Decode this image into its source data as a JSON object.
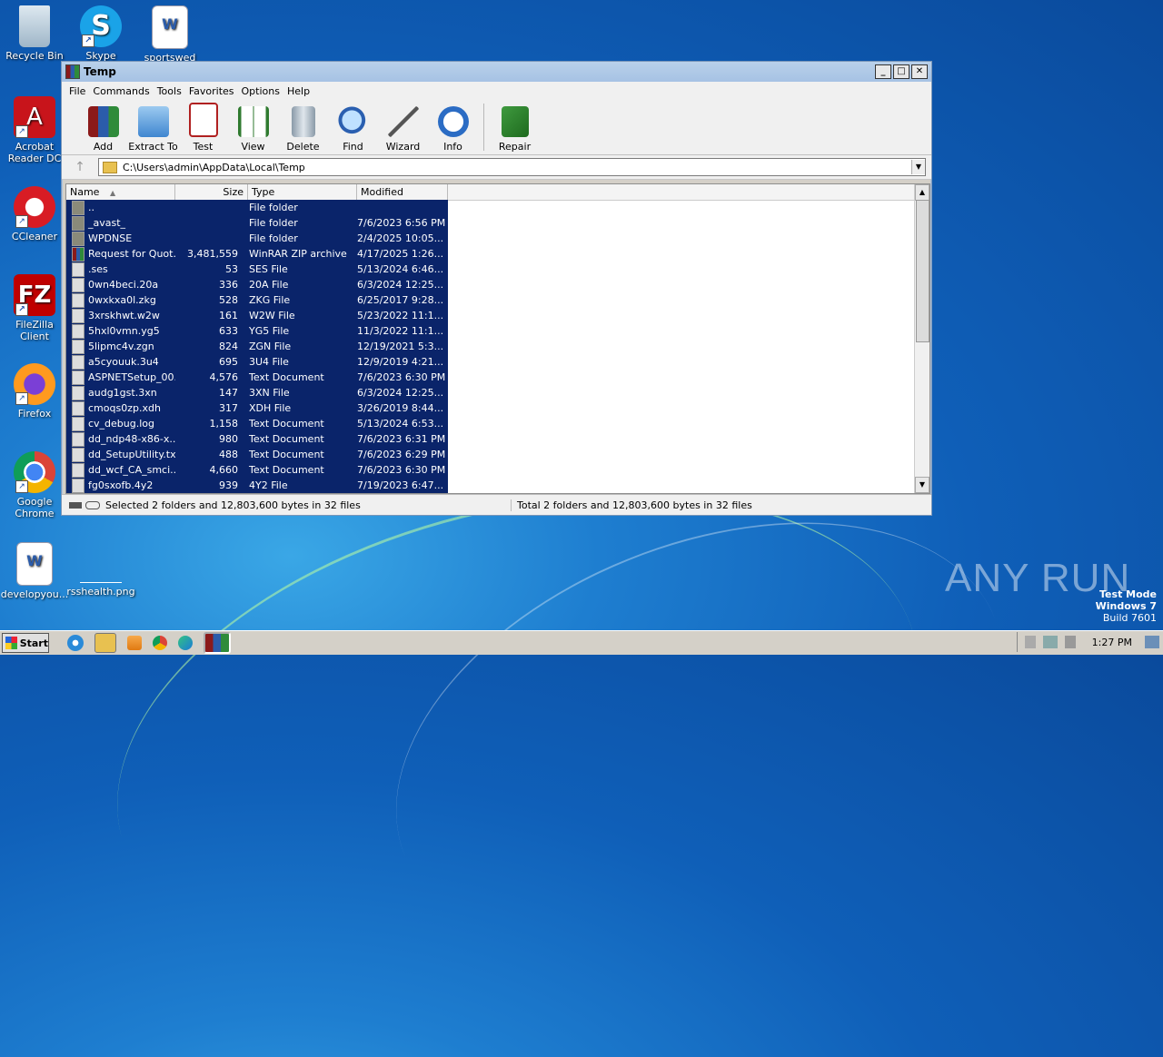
{
  "desktop": {
    "icons": [
      {
        "label": "Recycle Bin",
        "icon": "recycle-bin-icon"
      },
      {
        "label": "Skype",
        "icon": "skype-icon"
      },
      {
        "label": "sportswed",
        "icon": "word-doc-icon"
      },
      {
        "label": "Acrobat Reader DC",
        "icon": "acrobat-icon"
      },
      {
        "label": "CCleaner",
        "icon": "ccleaner-icon"
      },
      {
        "label": "FileZilla Client",
        "icon": "filezilla-icon"
      },
      {
        "label": "Firefox",
        "icon": "firefox-icon"
      },
      {
        "label": "Google Chrome",
        "icon": "chrome-icon"
      },
      {
        "label": "developyou...",
        "icon": "word-doc-icon"
      },
      {
        "label": "rsshealth.png",
        "icon": "image-file-icon"
      }
    ],
    "watermark": {
      "mode": "Test Mode",
      "os": "Windows 7",
      "build": "Build 7601"
    },
    "brand": "ANY RUN"
  },
  "window": {
    "title": "Temp",
    "menu": [
      "File",
      "Commands",
      "Tools",
      "Favorites",
      "Options",
      "Help"
    ],
    "toolbar": [
      "Add",
      "Extract To",
      "Test",
      "View",
      "Delete",
      "Find",
      "Wizard",
      "Info",
      "Repair"
    ],
    "address": "C:\\Users\\admin\\AppData\\Local\\Temp",
    "columns": {
      "name": "Name",
      "size": "Size",
      "type": "Type",
      "modified": "Modified"
    },
    "files": [
      {
        "name": "..",
        "size": "",
        "type": "File folder",
        "modified": "",
        "kind": "folder"
      },
      {
        "name": "_avast_",
        "size": "",
        "type": "File folder",
        "modified": "7/6/2023 6:56 PM",
        "kind": "folder"
      },
      {
        "name": "WPDNSE",
        "size": "",
        "type": "File folder",
        "modified": "2/4/2025 10:05...",
        "kind": "folder"
      },
      {
        "name": "Request for Quot...",
        "size": "3,481,559",
        "type": "WinRAR ZIP archive",
        "modified": "4/17/2025 1:26...",
        "kind": "zip"
      },
      {
        "name": ".ses",
        "size": "53",
        "type": "SES File",
        "modified": "5/13/2024 6:46...",
        "kind": "file"
      },
      {
        "name": "0wn4beci.20a",
        "size": "336",
        "type": "20A File",
        "modified": "6/3/2024 12:25...",
        "kind": "file"
      },
      {
        "name": "0wxkxa0l.zkg",
        "size": "528",
        "type": "ZKG File",
        "modified": "6/25/2017 9:28...",
        "kind": "file"
      },
      {
        "name": "3xrskhwt.w2w",
        "size": "161",
        "type": "W2W File",
        "modified": "5/23/2022 11:1...",
        "kind": "file"
      },
      {
        "name": "5hxl0vmn.yg5",
        "size": "633",
        "type": "YG5 File",
        "modified": "11/3/2022 11:1...",
        "kind": "file"
      },
      {
        "name": "5lipmc4v.zgn",
        "size": "824",
        "type": "ZGN File",
        "modified": "12/19/2021 5:3...",
        "kind": "file"
      },
      {
        "name": "a5cyouuk.3u4",
        "size": "695",
        "type": "3U4 File",
        "modified": "12/9/2019 4:21...",
        "kind": "file"
      },
      {
        "name": "ASPNETSetup_00...",
        "size": "4,576",
        "type": "Text Document",
        "modified": "7/6/2023 6:30 PM",
        "kind": "file"
      },
      {
        "name": "audg1gst.3xn",
        "size": "147",
        "type": "3XN File",
        "modified": "6/3/2024 12:25...",
        "kind": "file"
      },
      {
        "name": "cmoqs0zp.xdh",
        "size": "317",
        "type": "XDH File",
        "modified": "3/26/2019 8:44...",
        "kind": "file"
      },
      {
        "name": "cv_debug.log",
        "size": "1,158",
        "type": "Text Document",
        "modified": "5/13/2024 6:53...",
        "kind": "file"
      },
      {
        "name": "dd_ndp48-x86-x...",
        "size": "980",
        "type": "Text Document",
        "modified": "7/6/2023 6:31 PM",
        "kind": "file"
      },
      {
        "name": "dd_SetupUtility.txt",
        "size": "488",
        "type": "Text Document",
        "modified": "7/6/2023 6:29 PM",
        "kind": "file"
      },
      {
        "name": "dd_wcf_CA_smci...",
        "size": "4,660",
        "type": "Text Document",
        "modified": "7/6/2023 6:30 PM",
        "kind": "file"
      },
      {
        "name": "fg0sxofb.4y2",
        "size": "939",
        "type": "4Y2 File",
        "modified": "7/19/2023 6:47...",
        "kind": "file"
      }
    ],
    "status_left": "Selected 2 folders and 12,803,600 bytes in 32 files",
    "status_right": "Total 2 folders and 12,803,600 bytes in 32 files"
  },
  "taskbar": {
    "start": "Start",
    "clock": "1:27 PM"
  }
}
